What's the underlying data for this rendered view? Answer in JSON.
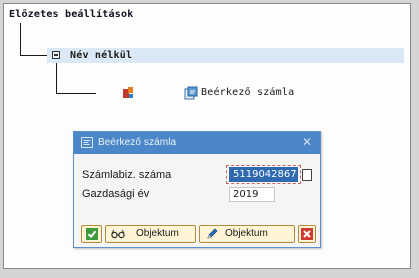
{
  "tree": {
    "title": "Előzetes beállítások",
    "node_label": "Név nélkül",
    "doc_label": "Beérkező számla"
  },
  "dialog": {
    "title": "Beérkező számla",
    "close_glyph": "✕",
    "fields": [
      {
        "label": "Számlabiz. száma",
        "value": "5119042867"
      },
      {
        "label": "Gazdasági év",
        "value": "2019"
      }
    ],
    "buttons": [
      {
        "icon": "checkmark-icon"
      },
      {
        "icon": "glasses-icon",
        "label": "Objektum"
      },
      {
        "icon": "pencil-icon",
        "label": "Objektum"
      },
      {
        "icon": "cancel-icon"
      }
    ]
  },
  "colors": {
    "titlebar": "#4a86c8",
    "selection": "#2f6ab0",
    "button_border": "#b48c3c",
    "button_bg": "#fff5d6"
  }
}
